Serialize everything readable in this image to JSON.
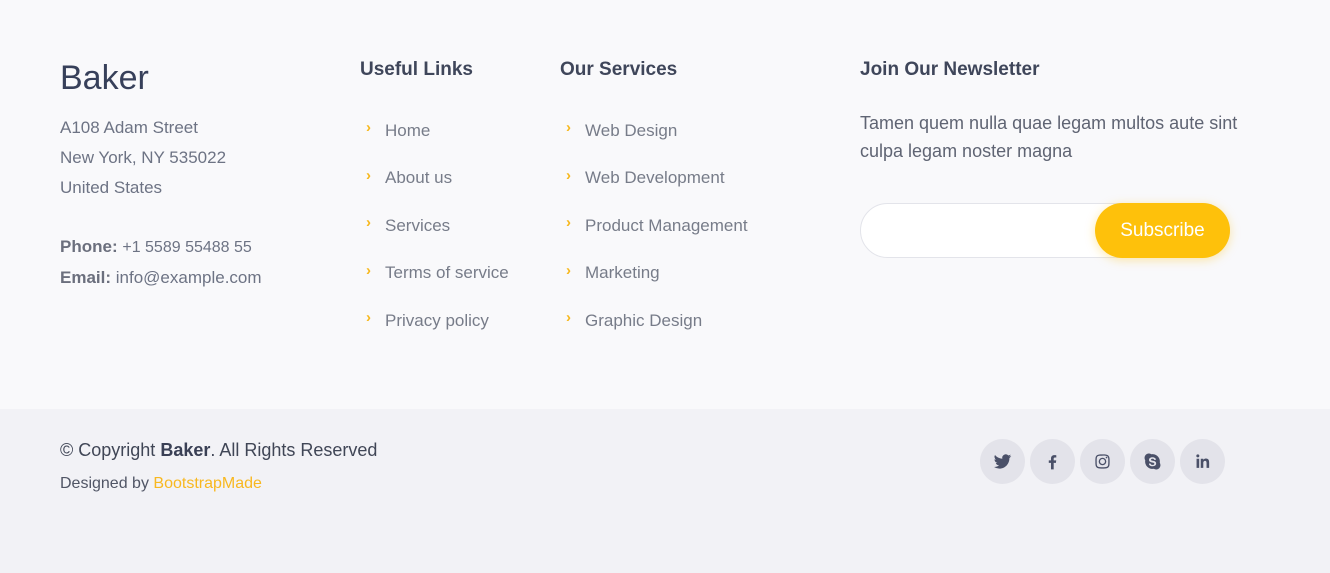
{
  "brand": {
    "name": "Baker"
  },
  "address": {
    "line1": "A108 Adam Street",
    "line2": "New York, NY 535022",
    "line3": "United States"
  },
  "contact": {
    "phone_label": "Phone:",
    "phone": "+1 5589 55488 55",
    "email_label": "Email:",
    "email": "info@example.com"
  },
  "useful_links": {
    "title": "Useful Links",
    "items": [
      "Home",
      "About us",
      "Services",
      "Terms of service",
      "Privacy policy"
    ]
  },
  "services": {
    "title": "Our Services",
    "items": [
      "Web Design",
      "Web Development",
      "Product Management",
      "Marketing",
      "Graphic Design"
    ]
  },
  "newsletter": {
    "title": "Join Our Newsletter",
    "text": "Tamen quem nulla quae legam multos aute sint culpa legam noster magna",
    "input_value": "",
    "button_label": "Subscribe"
  },
  "copyright": {
    "prefix": "© Copyright",
    "brand": "Baker",
    "suffix": ". All Rights Reserved"
  },
  "credits": {
    "prefix": "Designed by",
    "link": "BootstrapMade"
  },
  "social": [
    "twitter-icon",
    "facebook-icon",
    "instagram-icon",
    "skype-icon",
    "linkedin-icon"
  ],
  "colors": {
    "accent": "#fec10b",
    "link_accent": "#f8b820",
    "heading": "#3f465a"
  }
}
